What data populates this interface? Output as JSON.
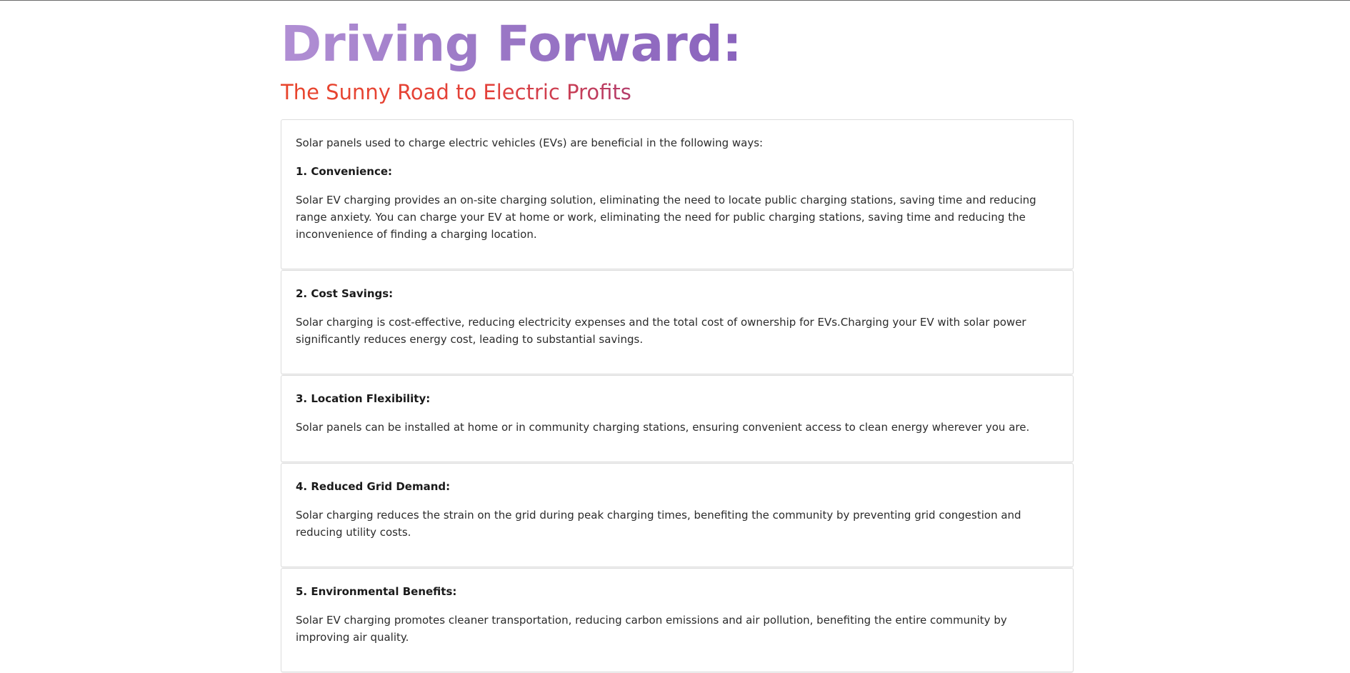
{
  "header": {
    "title": "Driving Forward:",
    "subtitle": "The Sunny Road to Electric Profits"
  },
  "intro": "Solar panels used to charge electric vehicles (EVs) are beneficial in the following ways:",
  "benefits": [
    {
      "heading": "1. Convenience:",
      "body": "Solar EV charging provides an on-site charging solution, eliminating the need to locate public charging stations, saving time and reducing range anxiety. You can charge your EV at home or work, eliminating the need for public charging stations, saving time and reducing the inconvenience of finding a charging location."
    },
    {
      "heading": "2. Cost Savings:",
      "body": "Solar charging is cost-effective, reducing electricity expenses and the total cost of ownership for EVs.Charging your EV with solar power significantly reduces energy cost, leading to substantial savings."
    },
    {
      "heading": "3. Location Flexibility:",
      "body": "Solar panels can be installed at home or in community charging stations, ensuring convenient access to clean energy wherever you are."
    },
    {
      "heading": "4. Reduced Grid Demand:",
      "body": "Solar charging reduces the strain on the grid during peak charging times, benefiting the community by preventing grid congestion and reducing utility costs."
    },
    {
      "heading": "5. Environmental Benefits:",
      "body": "Solar EV charging promotes cleaner transportation, reducing carbon emissions and air pollution, benefiting the entire community by improving air quality."
    }
  ],
  "colors": {
    "title_gradient_start": "#b18fd4",
    "title_gradient_end": "#8a63bd",
    "subtitle_gradient_start": "#e8452c",
    "subtitle_gradient_end": "#b33c6b",
    "card_border": "#dcdcdc",
    "body_text": "#2b2b2b"
  }
}
